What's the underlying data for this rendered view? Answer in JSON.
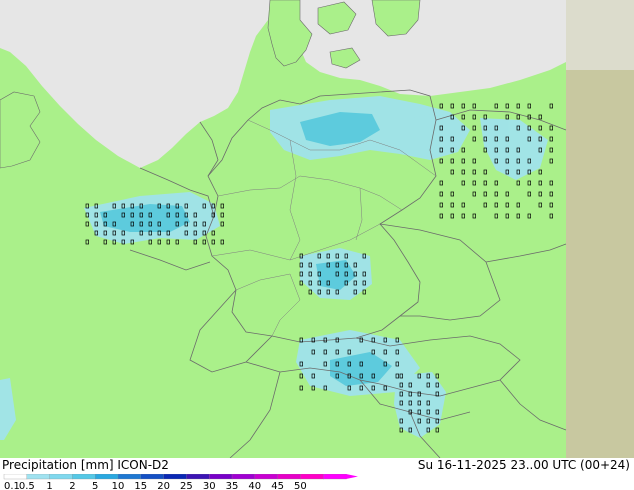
{
  "map": {
    "colors": {
      "land": "#aaf08a",
      "sea": "#e6e6e6",
      "outside_domain": "#c8c8a0",
      "border": "#6b6b6b",
      "precip_light": "#a0e2f0",
      "precip_medium": "#55c8e6"
    },
    "precip_labels": [
      "1",
      "1",
      "2",
      "3",
      "5",
      "0",
      "4",
      "1",
      "2",
      "1"
    ]
  },
  "footer": {
    "title_left": "Precipitation [mm]  ICON-D2",
    "title_right": "Su 16-11-2025 23..00 UTC (00+24)"
  },
  "legend": {
    "ticks": [
      "0.1",
      "0.5",
      "1",
      "2",
      "5",
      "10",
      "15",
      "20",
      "25",
      "30",
      "35",
      "40",
      "45",
      "50"
    ],
    "colors": [
      "#ffffff",
      "#a0e2f0",
      "#80d8ee",
      "#55c8e6",
      "#2aa8e0",
      "#1e78d2",
      "#1450c4",
      "#0a28b4",
      "#3c14b4",
      "#7800c8",
      "#a000d2",
      "#c800d2",
      "#e600c8",
      "#ff00c8",
      "#ff00ff"
    ]
  }
}
